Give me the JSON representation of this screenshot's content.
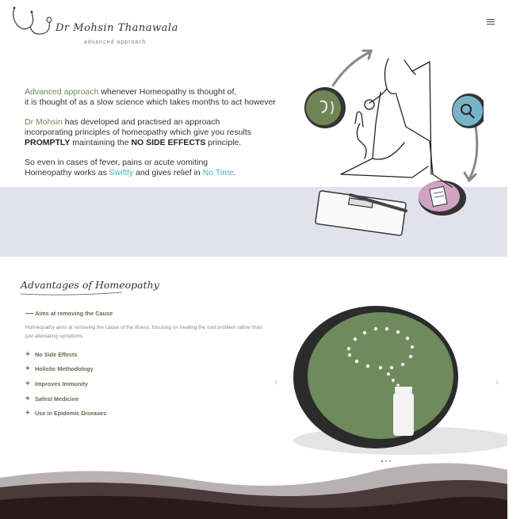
{
  "logo": {
    "name": "Dr Mohsin Thanawala",
    "tagline": "advanced approach"
  },
  "nav": {
    "menu_icon": "hamburger-icon"
  },
  "intro": {
    "p1": {
      "accent": "Advanced approach",
      "rest1": " whenever Homeopathy is thought of,",
      "line2": "it is thought of as a slow science which takes months to act however"
    },
    "p2": {
      "accent": "Dr Mohsin",
      "rest1": " has developed and practised an approach",
      "line2": "incorporating principles of homeopathy which give you results",
      "bold1": "PROMPTLY",
      "mid": " maintaining the ",
      "bold2": "NO SIDE EFFECTS",
      "end": " principle."
    },
    "p3": {
      "line1": "So even in cases of fever, pains or acute vomiting",
      "pre": "Homeopathy works as ",
      "accent1": "Swiftly",
      "mid": " and gives relief in ",
      "accent2": "No Time",
      "end": "."
    }
  },
  "advantages": {
    "title": "Advantages of Homeopathy",
    "open_item": {
      "label": "Aims at removing the Cause",
      "symbol": "—",
      "body": "Homeopathy aims at removing the cause of the illness, focusing on treating the root problem rather than just alleviating symptoms."
    },
    "items": [
      {
        "label": "No Side Effects",
        "symbol": "+"
      },
      {
        "label": "Holistic Methodology",
        "symbol": "+"
      },
      {
        "label": "Improves Immunity",
        "symbol": "+"
      },
      {
        "label": "Safest Medicine",
        "symbol": "+"
      },
      {
        "label": "Use in Epidemic Diseases",
        "symbol": "+"
      }
    ]
  },
  "carousel": {
    "prev": "‹",
    "next": "›",
    "slide_count": 3,
    "active_slide": 1
  },
  "colors": {
    "green": "#6b8a56",
    "teal": "#4ab0c2",
    "band": "#e2e2ec",
    "wave_dark": "#2a1a1a",
    "wave_mid": "#4b3a3a",
    "wave_light": "#b8b0b2"
  }
}
